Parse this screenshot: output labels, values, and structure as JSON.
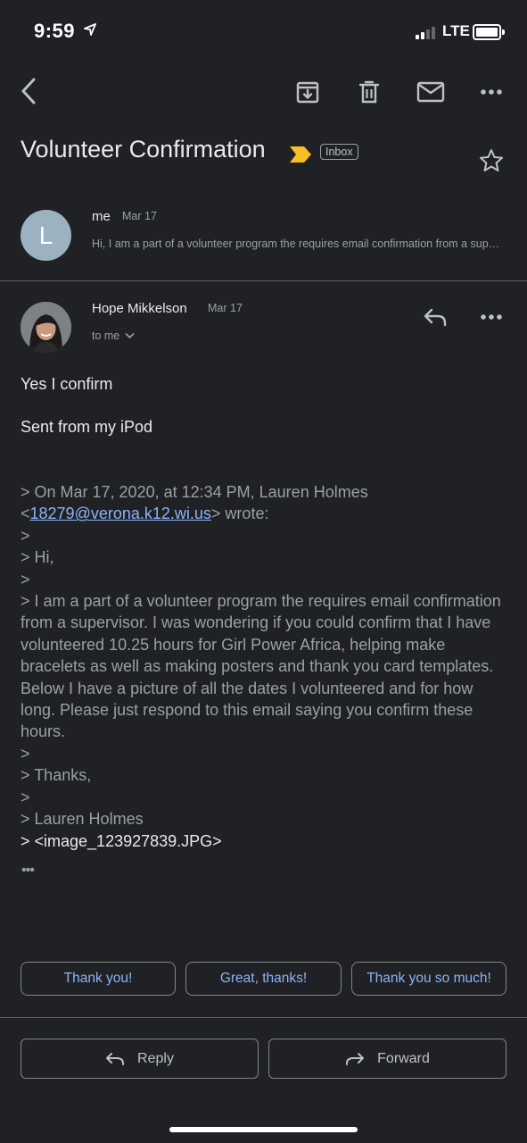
{
  "status_bar": {
    "time": "9:59",
    "network": "LTE"
  },
  "toolbar": {
    "back_icon": "chevron-left-icon",
    "archive_icon": "archive-icon",
    "delete_icon": "trash-icon",
    "mark_unread_icon": "mail-icon",
    "more_icon": "more-horizontal-icon"
  },
  "thread": {
    "subject": "Volunteer Confirmation",
    "label": "Inbox",
    "important_color": "#f6bf26"
  },
  "collapsed_message": {
    "avatar_letter": "L",
    "sender": "me",
    "date": "Mar 17",
    "snippet": "Hi, I am a part of a volunteer program the requires email confirmation from a supervisor. I was wondering if you could confirm"
  },
  "open_message": {
    "sender": "Hope Mikkelson",
    "date": "Mar 17",
    "recipient": "to me",
    "body_line1": "Yes I confirm",
    "body_line2": "Sent from my iPod",
    "quote_header_pre": "> On Mar 17, 2020, at 12:34 PM, Lauren Holmes\n<",
    "quote_email": "18279@verona.k12.wi.us",
    "quote_header_post": "> wrote:",
    "quote_body": "\n>\n> Hi,\n>\n> I am a part of a volunteer program the requires email confirmation from a supervisor. I was wondering if you could confirm that I have volunteered 10.25 hours for Girl Power Africa, helping make bracelets as well as making posters and thank you card templates. Below I have a picture of all the dates I volunteered and for how long. Please just respond to this email saying you confirm these hours.\n>\n> Thanks,\n>\n> Lauren Holmes\n",
    "quote_attachment": "> <image_123927839.JPG>",
    "ellipsis": "•••"
  },
  "smart_replies": [
    "Thank you!",
    "Great, thanks!",
    "Thank you so much!"
  ],
  "actions": {
    "reply": "Reply",
    "forward": "Forward"
  },
  "colors": {
    "background": "#202124",
    "link": "#8ab4f8",
    "avatar_me": "#9db2c0"
  }
}
